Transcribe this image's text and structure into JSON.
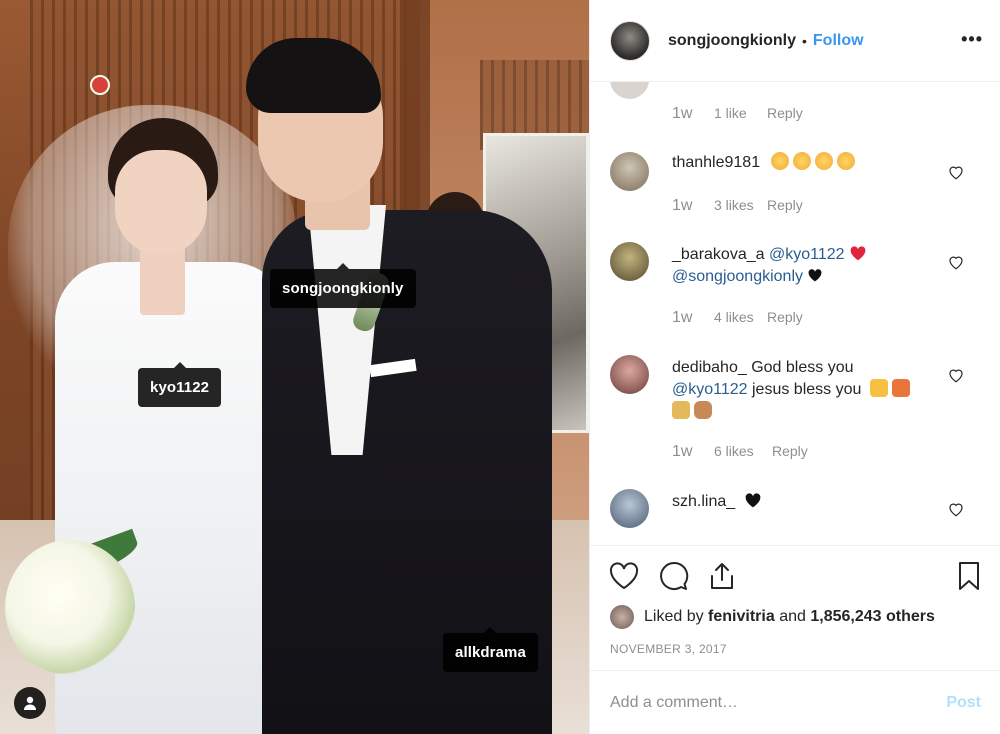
{
  "post": {
    "username": "songjoongkionly",
    "separator": "•",
    "follow_label": "Follow",
    "more_label": "•••",
    "photo_tags": [
      "kyo1122",
      "songjoongkionly",
      "allkdrama"
    ]
  },
  "comments": [
    {
      "user": "",
      "text": "",
      "time": "1w",
      "likes": "1 like",
      "reply": "Reply"
    },
    {
      "user": "thanhle9181",
      "text": "",
      "emoji": [
        "disappointed-face",
        "disappointed-face",
        "disappointed-face",
        "disappointed-face"
      ],
      "time": "1w",
      "likes": "3 likes",
      "reply": "Reply"
    },
    {
      "user": "_barakova_a",
      "mention1": "@kyo1122",
      "mention2": "@songjoongkionly",
      "emoji": [
        "red-heart",
        "black-heart"
      ],
      "time": "1w",
      "likes": "4 likes",
      "reply": "Reply"
    },
    {
      "user": "dedibaho_",
      "text": "God bless you",
      "mention1": "@kyo1122",
      "text2": "jesus bless you",
      "emoji": [
        "folded-hands",
        "two-hearts",
        "family",
        "ear-with-hearing-aid"
      ],
      "time": "1w",
      "likes": "6 likes",
      "reply": "Reply"
    },
    {
      "user": "szh.lina_",
      "emoji": [
        "black-heart"
      ]
    }
  ],
  "likes": {
    "prefix": "Liked by",
    "user": "fenivitria",
    "mid": "and",
    "count": "1,856,243 others"
  },
  "date": "NOVEMBER 3, 2017",
  "comment_box": {
    "placeholder": "Add a comment…",
    "post_label": "Post"
  },
  "colors": {
    "link_blue": "#3897f0",
    "mention_blue": "#2a5d90",
    "muted": "#8e8e8e",
    "post_disabled": "#b2dffc"
  }
}
